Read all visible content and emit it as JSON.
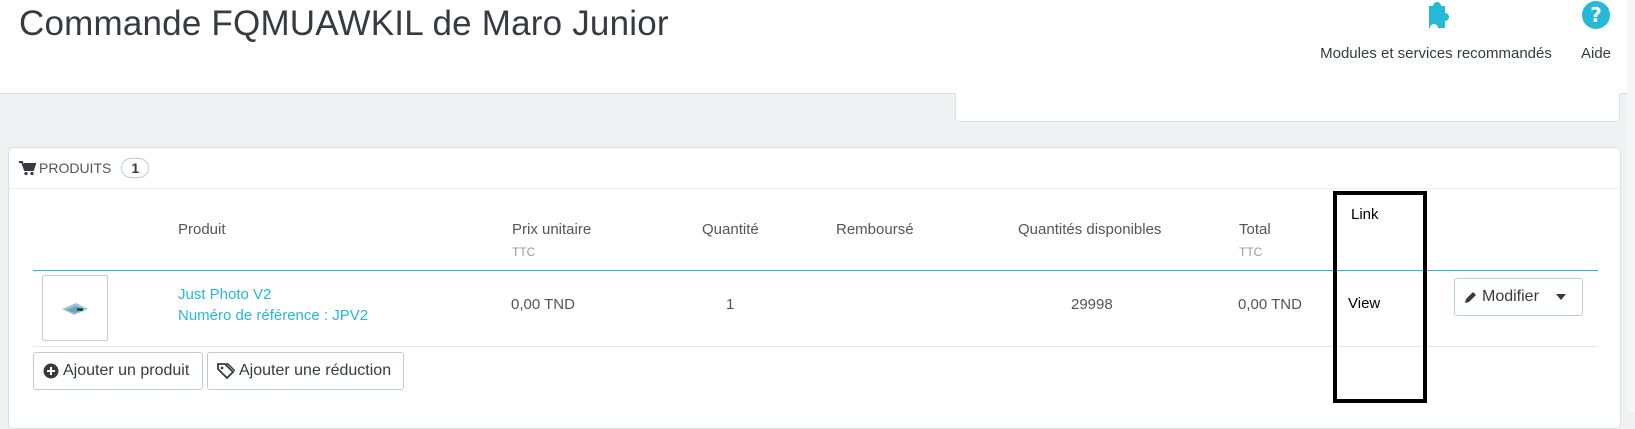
{
  "header": {
    "title": "Commande FQMUAWKIL de Maro Junior",
    "actions": [
      {
        "label": "Modules et services recommandés",
        "icon": "puzzle-icon"
      },
      {
        "label": "Aide",
        "icon": "help-icon"
      }
    ]
  },
  "products_panel": {
    "title": "PRODUITS",
    "count": "1",
    "columns": {
      "product": "Produit",
      "unit_price": "Prix unitaire",
      "unit_price_sub": "TTC",
      "quantity": "Quantité",
      "refunded": "Remboursé",
      "available": "Quantités disponibles",
      "total": "Total",
      "total_sub": "TTC"
    },
    "rows": [
      {
        "name": "Just Photo V2",
        "reference": "Numéro de référence : JPV2",
        "unit_price": "0,00 TND",
        "quantity": "1",
        "available": "29998",
        "total": "0,00 TND"
      }
    ],
    "edit_button": "Modifier",
    "add_product_button": "Ajouter un produit",
    "add_discount_button": "Ajouter une réduction"
  },
  "annotation": {
    "header_label": "Link",
    "row_label": "View"
  },
  "colors": {
    "accent": "#25b9d7",
    "title": "#363a41",
    "background": "#eff1f2"
  }
}
